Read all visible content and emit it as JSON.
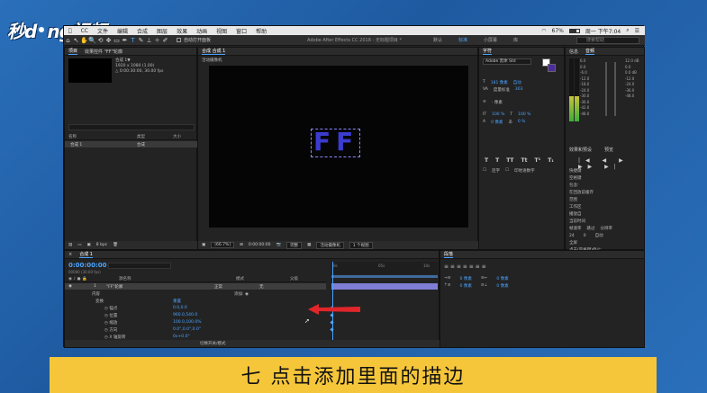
{
  "watermark": {
    "text_a": "秒d",
    "text_b": "ng视频"
  },
  "menubar": {
    "items": [
      "CC",
      "文件",
      "编辑",
      "合成",
      "图层",
      "效果",
      "动画",
      "视图",
      "窗口",
      "帮助"
    ],
    "battery": "67%",
    "datetime": "周一 下午7:04"
  },
  "toolbar": {
    "tools": [
      "↖",
      "✋",
      "🔍",
      "⟲",
      "✥",
      "▭",
      "✒",
      "T",
      "✎",
      "⊥",
      "✧",
      "✐"
    ],
    "auto_open_label": "自动打开面板",
    "title": "Adobe After Effects CC 2018 - 无标题项目 *",
    "workspaces": [
      "默认",
      "标准",
      "小屏幕",
      "库"
    ],
    "active_workspace": "标准",
    "search_placeholder": "搜索帮助"
  },
  "project_panel": {
    "tab": "项目",
    "effects_tab": "效果控件 \"FF\"轮廓",
    "comp_name": "合成 1▼",
    "comp_size": "1920 x 1080 (1.00)",
    "comp_duration": "△ 0:00:30:00, 30.00 fps",
    "columns": [
      "名称",
      "类型",
      "大小"
    ],
    "item_name": "合成 1",
    "item_type": "合成",
    "bpc": "8 bpc"
  },
  "comp_panel": {
    "tab": "合成 合成 1",
    "sub_label": "活动摄像机",
    "text_preview": "FF",
    "zoom": "(66.7%)",
    "timecode": "0:00:00:00",
    "resolution": "完整",
    "camera": "活动摄像机",
    "views": "1 个视图"
  },
  "character_panel": {
    "tab": "字符",
    "font": "Adobe 黑体 Std",
    "size_value": "181 像素",
    "size_auto": "自动",
    "kerning_label": "度量标准",
    "tracking": "303",
    "stroke_label": "- 像素",
    "v_scale": "100 %",
    "h_scale": "100 %",
    "baseline": "0 像素",
    "tsume": "0 %",
    "styles": [
      "T",
      "T",
      "TT",
      "Tt",
      "T¹",
      "T₁"
    ],
    "ligature_label": "连字",
    "hindi_label": "印地语数字"
  },
  "info_panel": {
    "tabs": [
      "信息",
      "音频"
    ],
    "db_left": [
      "6.0",
      "0.0",
      "-6.0",
      "-12.0",
      "-18.0",
      "-24.0",
      "-30.0",
      "-36.0",
      "-42.0",
      "-48.0"
    ],
    "db_right": [
      "12.0 dB",
      "0.0",
      "0.0 dB",
      "-12.0",
      "-24.0",
      "-36.0",
      "-48.0"
    ]
  },
  "preview_panel": {
    "tabs": [
      "效果和预设",
      "预览"
    ],
    "transport": "|◀ ◀ ▶ ▶▶ ▶|",
    "shortcut_label": "快捷键",
    "shortcut_value": "空格键",
    "include_label": "包含:",
    "cache_label": "在回放前缓存",
    "range_label": "范围",
    "range_value": "工作区",
    "play_from_label": "播放自",
    "play_from_value": "当前时间",
    "frame_rate_label": "帧速率",
    "skip_label": "跳过",
    "resolution_label": "分辨率",
    "frame_rate_value": "24",
    "skip_value": "0",
    "resolution_value": "自动",
    "fullscreen_label": "全屏",
    "stop_label": "点击(空格键)停止:",
    "stop_opt1": "如果缓存，则播放缓存的帧",
    "stop_opt2": "将时间移到预览时间"
  },
  "timeline": {
    "tab": "合成 1",
    "timecode": "0:00:00:00",
    "timecode_sub": "00000 (30.00 fps)",
    "columns": [
      "源名称",
      "模式",
      "父级"
    ],
    "layer_number": "1",
    "layer_name": "\"FF\"轮廓",
    "layer_mode": "正常",
    "layer_parent": "无",
    "contents_label": "内容",
    "add_label": "添加:",
    "transform_label": "变换",
    "reset_label": "重置",
    "props": [
      {
        "name": "锚点",
        "value": "0.0,0.0"
      },
      {
        "name": "位置",
        "value": "960.0,540.0"
      },
      {
        "name": "缩放",
        "value": "100.0,100.0%"
      },
      {
        "name": "方向",
        "value": "0.0°,0.0°,0.0°"
      },
      {
        "name": "X 轴旋转",
        "value": "0x+0.0°"
      },
      {
        "name": "Y 轴旋转",
        "value": "0x+0.0°"
      }
    ],
    "ruler_marks": [
      "0s",
      "05s",
      "10s"
    ],
    "footer_label": "切换开关/模式"
  },
  "paragraph_panel": {
    "tab": "段落",
    "indent_left": "0 像素",
    "indent_right": "0 像素",
    "space_before": "0 像素",
    "space_after": "0 像素"
  },
  "caption": {
    "text": "七 点击添加里面的描边"
  },
  "colors": {
    "background": "#1d5fa8",
    "accent_blue": "#4aa3ff",
    "caption_bg": "#f6c63a",
    "arrow_red": "#e0262b",
    "text_purple": "#3b3bd0"
  }
}
